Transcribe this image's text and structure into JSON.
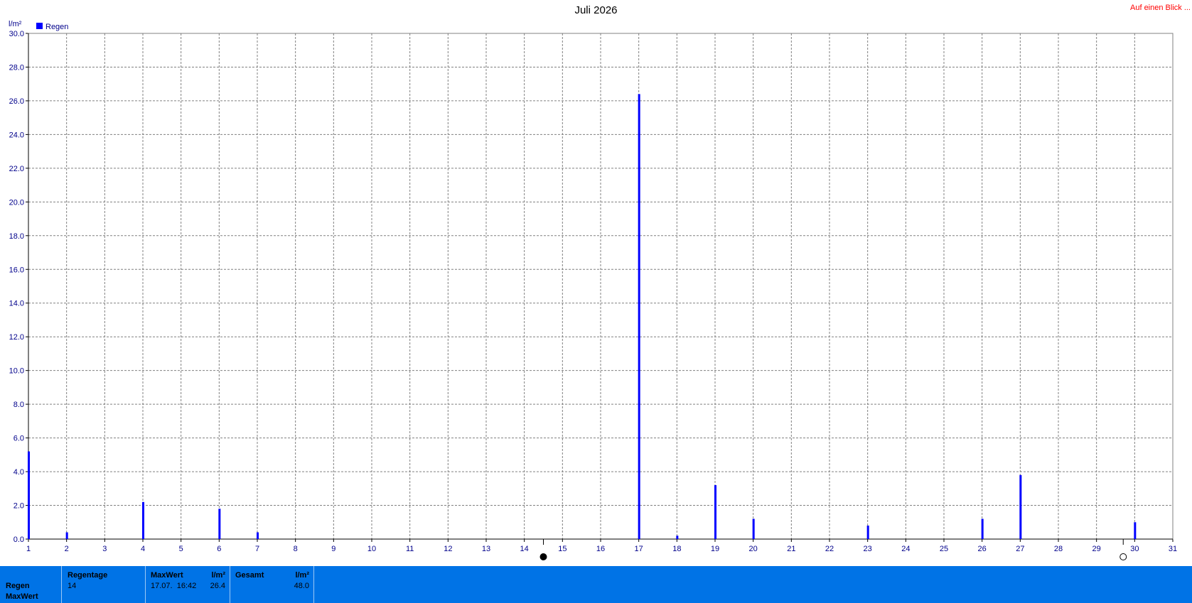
{
  "chart_data": {
    "type": "bar",
    "title": "Juli 2026",
    "ylabel": "l/m²",
    "xlabel": "",
    "ylim": [
      0,
      30
    ],
    "xlim": [
      1,
      31
    ],
    "grid": true,
    "legend_position": "top-left",
    "y_ticks": [
      "0.0",
      "2.0",
      "4.0",
      "6.0",
      "8.0",
      "10.0",
      "12.0",
      "14.0",
      "16.0",
      "18.0",
      "20.0",
      "22.0",
      "24.0",
      "26.0",
      "28.0",
      "30.0"
    ],
    "x_ticks": [
      "1",
      "2",
      "3",
      "4",
      "5",
      "6",
      "7",
      "8",
      "9",
      "10",
      "11",
      "12",
      "13",
      "14",
      "15",
      "16",
      "17",
      "18",
      "19",
      "20",
      "21",
      "22",
      "23",
      "24",
      "25",
      "26",
      "27",
      "28",
      "29",
      "30",
      "31"
    ],
    "series": [
      {
        "name": "Regen",
        "color": "#0000ff",
        "x": [
          1,
          2,
          4,
          6,
          7,
          17,
          18,
          19,
          20,
          23,
          26,
          27,
          30
        ],
        "values": [
          5.2,
          0.4,
          2.2,
          1.8,
          0.4,
          26.4,
          0.2,
          3.2,
          1.2,
          0.8,
          1.2,
          3.8,
          1.0
        ]
      }
    ],
    "moon_phases": [
      {
        "day": 14.5,
        "phase": "new-moon-icon"
      },
      {
        "day": 29.7,
        "phase": "full-moon-icon"
      }
    ]
  },
  "header": {
    "overview_link": "Auf einen Blick ..."
  },
  "footer": {
    "row_label_1": "Regen",
    "row_label_2": "MaxWert",
    "regentage_label": "Regentage",
    "regentage_value": "14",
    "maxwert_label": "MaxWert",
    "maxwert_unit": "l/m²",
    "maxwert_date": "17.07.  16:42",
    "maxwert_value": "26.4",
    "gesamt_label": "Gesamt",
    "gesamt_unit": "l/m²",
    "gesamt_value": "48.0"
  },
  "colors": {
    "bar": "#0000ff",
    "footer_bg": "#0073e6",
    "link": "#ff0000",
    "axis_text": "#00008b"
  }
}
